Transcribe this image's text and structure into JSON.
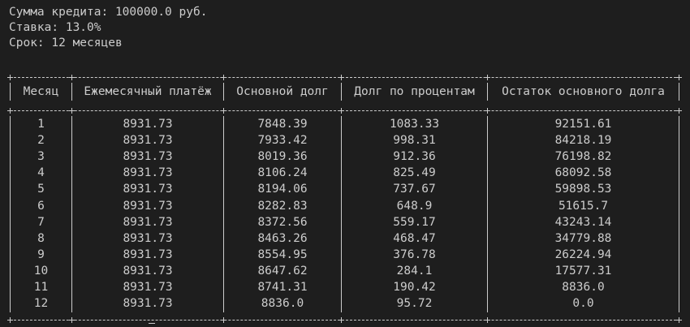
{
  "summary": {
    "top_fragment": "┌ ( ) ┐",
    "amount": "Сумма кредита: 100000.0 руб.",
    "rate": "Ставка: 13.0%",
    "term": "Срок: 12 месяцев"
  },
  "table": {
    "headers": [
      "Месяц",
      "Ежемесячный платёж",
      "Основной долг",
      "Долг по процентам",
      "Остаток основного долга"
    ],
    "rows": [
      [
        "1",
        "8931.73",
        "7848.39",
        "1083.33",
        "92151.61"
      ],
      [
        "2",
        "8931.73",
        "7933.42",
        "998.31",
        "84218.19"
      ],
      [
        "3",
        "8931.73",
        "8019.36",
        "912.36",
        "76198.82"
      ],
      [
        "4",
        "8931.73",
        "8106.24",
        "825.49",
        "68092.58"
      ],
      [
        "5",
        "8931.73",
        "8194.06",
        "737.67",
        "59898.53"
      ],
      [
        "6",
        "8931.73",
        "8282.83",
        "648.9",
        "51615.7"
      ],
      [
        "7",
        "8931.73",
        "8372.56",
        "559.17",
        "43243.14"
      ],
      [
        "8",
        "8931.73",
        "8463.26",
        "468.47",
        "34779.88"
      ],
      [
        "9",
        "8931.73",
        "8554.95",
        "376.78",
        "26224.94"
      ],
      [
        "10",
        "8931.73",
        "8647.62",
        "284.1",
        "17577.31"
      ],
      [
        "11",
        "8931.73",
        "8741.31",
        "190.42",
        "8836.0"
      ],
      [
        "12",
        "8931.73",
        "8836.0",
        "95.72",
        "0.0"
      ]
    ]
  }
}
